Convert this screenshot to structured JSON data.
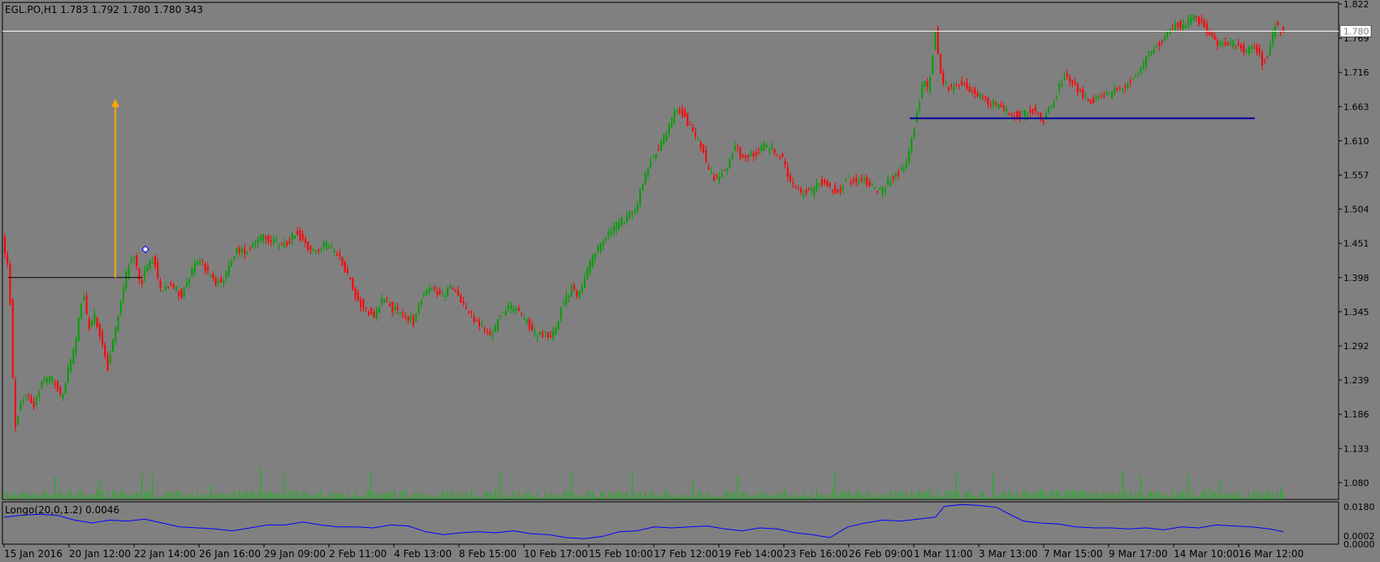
{
  "window": {
    "title": "EGL.PO,H1  1.783 1.792 1.780 1.780  343"
  },
  "chart_data": {
    "type": "candlestick",
    "symbol": "EGL.PO",
    "timeframe": "H1",
    "ohlc_readout": {
      "open": 1.783,
      "high": 1.792,
      "low": 1.78,
      "close": 1.78,
      "volume": 343
    },
    "price_axis": {
      "ticks": [
        "1.822",
        "1.769",
        "1.716",
        "1.663",
        "1.610",
        "1.557",
        "1.504",
        "1.451",
        "1.398",
        "1.345",
        "1.292",
        "1.239",
        "1.186",
        "1.133",
        "1.080"
      ],
      "min": 1.054,
      "max": 1.822
    },
    "current_price_label": "1.780",
    "time_axis": {
      "labels": [
        "15 Jan 2016",
        "20 Jan 12:00",
        "22 Jan 14:00",
        "26 Jan 16:00",
        "29 Jan 09:00",
        "2 Feb 11:00",
        "4 Feb 13:00",
        "8 Feb 15:00",
        "10 Feb 17:00",
        "15 Feb 10:00",
        "17 Feb 12:00",
        "19 Feb 14:00",
        "23 Feb 16:00",
        "26 Feb 09:00",
        "1 Mar 11:00",
        "3 Mar 13:00",
        "7 Mar 15:00",
        "9 Mar 17:00",
        "14 Mar 10:00",
        "16 Mar 12:00"
      ]
    },
    "price_path": [
      [
        0,
        1.46
      ],
      [
        8,
        1.4
      ],
      [
        14,
        1.16
      ],
      [
        20,
        1.2
      ],
      [
        28,
        1.22
      ],
      [
        36,
        1.2
      ],
      [
        46,
        1.24
      ],
      [
        58,
        1.24
      ],
      [
        68,
        1.21
      ],
      [
        76,
        1.26
      ],
      [
        84,
        1.3
      ],
      [
        92,
        1.38
      ],
      [
        98,
        1.32
      ],
      [
        106,
        1.34
      ],
      [
        114,
        1.29
      ],
      [
        120,
        1.26
      ],
      [
        128,
        1.31
      ],
      [
        134,
        1.36
      ],
      [
        142,
        1.41
      ],
      [
        150,
        1.43
      ],
      [
        158,
        1.39
      ],
      [
        166,
        1.42
      ],
      [
        172,
        1.43
      ],
      [
        180,
        1.38
      ],
      [
        192,
        1.39
      ],
      [
        204,
        1.37
      ],
      [
        214,
        1.4
      ],
      [
        224,
        1.43
      ],
      [
        232,
        1.41
      ],
      [
        242,
        1.39
      ],
      [
        254,
        1.4
      ],
      [
        266,
        1.44
      ],
      [
        278,
        1.44
      ],
      [
        290,
        1.46
      ],
      [
        300,
        1.46
      ],
      [
        312,
        1.45
      ],
      [
        324,
        1.45
      ],
      [
        334,
        1.47
      ],
      [
        344,
        1.45
      ],
      [
        356,
        1.44
      ],
      [
        370,
        1.45
      ],
      [
        384,
        1.43
      ],
      [
        394,
        1.4
      ],
      [
        402,
        1.37
      ],
      [
        412,
        1.35
      ],
      [
        424,
        1.34
      ],
      [
        434,
        1.37
      ],
      [
        444,
        1.35
      ],
      [
        456,
        1.34
      ],
      [
        468,
        1.33
      ],
      [
        478,
        1.37
      ],
      [
        490,
        1.38
      ],
      [
        500,
        1.37
      ],
      [
        510,
        1.38
      ],
      [
        520,
        1.37
      ],
      [
        528,
        1.35
      ],
      [
        538,
        1.33
      ],
      [
        548,
        1.32
      ],
      [
        558,
        1.31
      ],
      [
        566,
        1.34
      ],
      [
        576,
        1.35
      ],
      [
        586,
        1.35
      ],
      [
        596,
        1.33
      ],
      [
        606,
        1.31
      ],
      [
        618,
        1.31
      ],
      [
        628,
        1.31
      ],
      [
        638,
        1.36
      ],
      [
        648,
        1.38
      ],
      [
        656,
        1.37
      ],
      [
        664,
        1.4
      ],
      [
        672,
        1.43
      ],
      [
        682,
        1.45
      ],
      [
        692,
        1.47
      ],
      [
        700,
        1.48
      ],
      [
        710,
        1.49
      ],
      [
        720,
        1.5
      ],
      [
        730,
        1.55
      ],
      [
        738,
        1.58
      ],
      [
        748,
        1.6
      ],
      [
        758,
        1.63
      ],
      [
        768,
        1.66
      ],
      [
        776,
        1.65
      ],
      [
        786,
        1.62
      ],
      [
        796,
        1.6
      ],
      [
        804,
        1.56
      ],
      [
        814,
        1.55
      ],
      [
        824,
        1.57
      ],
      [
        834,
        1.6
      ],
      [
        844,
        1.58
      ],
      [
        854,
        1.59
      ],
      [
        864,
        1.6
      ],
      [
        876,
        1.6
      ],
      [
        888,
        1.58
      ],
      [
        898,
        1.54
      ],
      [
        908,
        1.53
      ],
      [
        920,
        1.53
      ],
      [
        930,
        1.55
      ],
      [
        940,
        1.54
      ],
      [
        950,
        1.53
      ],
      [
        960,
        1.55
      ],
      [
        970,
        1.55
      ],
      [
        980,
        1.55
      ],
      [
        990,
        1.54
      ],
      [
        1000,
        1.53
      ],
      [
        1010,
        1.55
      ],
      [
        1020,
        1.56
      ],
      [
        1030,
        1.58
      ],
      [
        1036,
        1.62
      ],
      [
        1042,
        1.66
      ],
      [
        1048,
        1.7
      ],
      [
        1054,
        1.69
      ],
      [
        1062,
        1.78
      ],
      [
        1068,
        1.71
      ],
      [
        1078,
        1.69
      ],
      [
        1090,
        1.7
      ],
      [
        1100,
        1.69
      ],
      [
        1112,
        1.68
      ],
      [
        1124,
        1.67
      ],
      [
        1136,
        1.66
      ],
      [
        1148,
        1.65
      ],
      [
        1160,
        1.65
      ],
      [
        1172,
        1.66
      ],
      [
        1184,
        1.64
      ],
      [
        1196,
        1.67
      ],
      [
        1208,
        1.71
      ],
      [
        1218,
        1.7
      ],
      [
        1230,
        1.68
      ],
      [
        1240,
        1.67
      ],
      [
        1250,
        1.68
      ],
      [
        1260,
        1.68
      ],
      [
        1270,
        1.69
      ],
      [
        1282,
        1.7
      ],
      [
        1294,
        1.72
      ],
      [
        1304,
        1.74
      ],
      [
        1316,
        1.76
      ],
      [
        1326,
        1.78
      ],
      [
        1336,
        1.79
      ],
      [
        1346,
        1.79
      ],
      [
        1356,
        1.8
      ],
      [
        1366,
        1.79
      ],
      [
        1376,
        1.77
      ],
      [
        1386,
        1.76
      ],
      [
        1396,
        1.76
      ],
      [
        1406,
        1.76
      ],
      [
        1416,
        1.75
      ],
      [
        1426,
        1.76
      ],
      [
        1434,
        1.73
      ],
      [
        1440,
        1.74
      ],
      [
        1448,
        1.79
      ],
      [
        1456,
        1.78
      ]
    ],
    "annotations": [
      {
        "type": "horizontal-line",
        "name": "support-line-jan",
        "price": 1.398,
        "color": "#000000"
      },
      {
        "type": "horizontal-line",
        "name": "support-line-mar",
        "price": 1.645,
        "color": "#0000a0"
      },
      {
        "type": "horizontal-line",
        "name": "current-price-line",
        "price": 1.78,
        "color": "#ffffff"
      },
      {
        "type": "arrow",
        "name": "up-arrow",
        "from_price": 1.398,
        "to_price": 1.675,
        "color": "#ffa500"
      }
    ],
    "volume": {
      "color": "#00c000"
    },
    "indicator": {
      "label": "Longo(20,0,1.2) 0.0046",
      "ticks": [
        "0.0180",
        "0.0002",
        "0.0000"
      ],
      "min": 0.0,
      "max": 0.02,
      "color": "#0000ff",
      "path": [
        [
          0,
          0.013
        ],
        [
          20,
          0.014
        ],
        [
          40,
          0.0145
        ],
        [
          60,
          0.014
        ],
        [
          80,
          0.0115
        ],
        [
          100,
          0.01
        ],
        [
          120,
          0.0115
        ],
        [
          140,
          0.011
        ],
        [
          160,
          0.012
        ],
        [
          180,
          0.01
        ],
        [
          200,
          0.008
        ],
        [
          220,
          0.0075
        ],
        [
          240,
          0.007
        ],
        [
          260,
          0.006
        ],
        [
          280,
          0.0075
        ],
        [
          300,
          0.009
        ],
        [
          320,
          0.009
        ],
        [
          340,
          0.0105
        ],
        [
          360,
          0.009
        ],
        [
          380,
          0.008
        ],
        [
          400,
          0.008
        ],
        [
          420,
          0.0075
        ],
        [
          440,
          0.009
        ],
        [
          460,
          0.0085
        ],
        [
          480,
          0.0055
        ],
        [
          500,
          0.004
        ],
        [
          520,
          0.005
        ],
        [
          540,
          0.0055
        ],
        [
          560,
          0.005
        ],
        [
          580,
          0.006
        ],
        [
          600,
          0.0045
        ],
        [
          620,
          0.004
        ],
        [
          640,
          0.0025
        ],
        [
          660,
          0.002
        ],
        [
          680,
          0.003
        ],
        [
          700,
          0.0055
        ],
        [
          720,
          0.006
        ],
        [
          740,
          0.008
        ],
        [
          760,
          0.0075
        ],
        [
          780,
          0.008
        ],
        [
          800,
          0.0085
        ],
        [
          820,
          0.007
        ],
        [
          840,
          0.006
        ],
        [
          860,
          0.0075
        ],
        [
          880,
          0.007
        ],
        [
          900,
          0.005
        ],
        [
          920,
          0.004
        ],
        [
          940,
          0.0025
        ],
        [
          960,
          0.008
        ],
        [
          980,
          0.01
        ],
        [
          1000,
          0.0115
        ],
        [
          1020,
          0.011
        ],
        [
          1040,
          0.012
        ],
        [
          1060,
          0.013
        ],
        [
          1070,
          0.0185
        ],
        [
          1090,
          0.0195
        ],
        [
          1110,
          0.019
        ],
        [
          1130,
          0.018
        ],
        [
          1140,
          0.0155
        ],
        [
          1160,
          0.011
        ],
        [
          1180,
          0.01
        ],
        [
          1200,
          0.0095
        ],
        [
          1220,
          0.008
        ],
        [
          1240,
          0.0075
        ],
        [
          1260,
          0.0075
        ],
        [
          1280,
          0.007
        ],
        [
          1300,
          0.0075
        ],
        [
          1320,
          0.0065
        ],
        [
          1340,
          0.008
        ],
        [
          1360,
          0.0075
        ],
        [
          1380,
          0.009
        ],
        [
          1400,
          0.0085
        ],
        [
          1420,
          0.008
        ],
        [
          1440,
          0.007
        ],
        [
          1456,
          0.0055
        ]
      ]
    }
  }
}
